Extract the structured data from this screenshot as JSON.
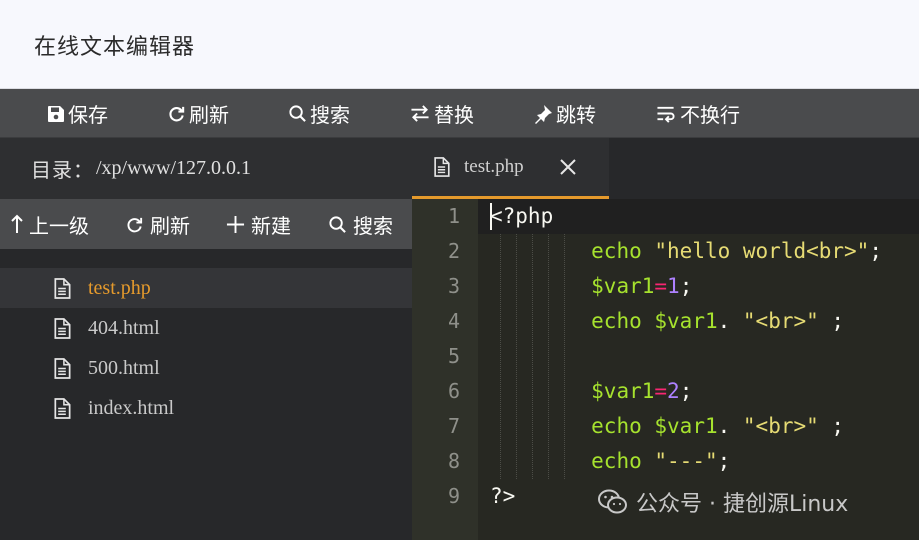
{
  "app": {
    "title": "在线文本编辑器"
  },
  "toolbar": {
    "save": "保存",
    "refresh": "刷新",
    "search": "搜索",
    "replace": "替换",
    "goto": "跳转",
    "nowrap": "不换行"
  },
  "sidebar": {
    "dir_label": "目录：",
    "dir_path": "/xp/www/127.0.0.1",
    "toolbar": {
      "up": "上一级",
      "refresh": "刷新",
      "new": "新建",
      "search": "搜索"
    },
    "files": [
      "test.php",
      "404.html",
      "500.html",
      "index.html"
    ],
    "active_file": "test.php"
  },
  "editor": {
    "tab": {
      "label": "test.php"
    },
    "line_numbers": [
      "1",
      "2",
      "3",
      "4",
      "5",
      "6",
      "7",
      "8",
      "9"
    ],
    "lines": [
      "<?php",
      "        echo \"hello world<br>\";",
      "        $var1=1;",
      "        echo $var1. \"<br>\" ;",
      "",
      "        $var1=2;",
      "        echo $var1. \"<br>\" ;",
      "        echo \"---\";",
      "?>"
    ]
  },
  "watermark": {
    "text": "公众号 · 捷创源Linux"
  },
  "colors": {
    "accent": "#e59a2c",
    "keyword": "#a6e22e",
    "string": "#e6db74",
    "number": "#ae81ff",
    "operator": "#f92672"
  }
}
